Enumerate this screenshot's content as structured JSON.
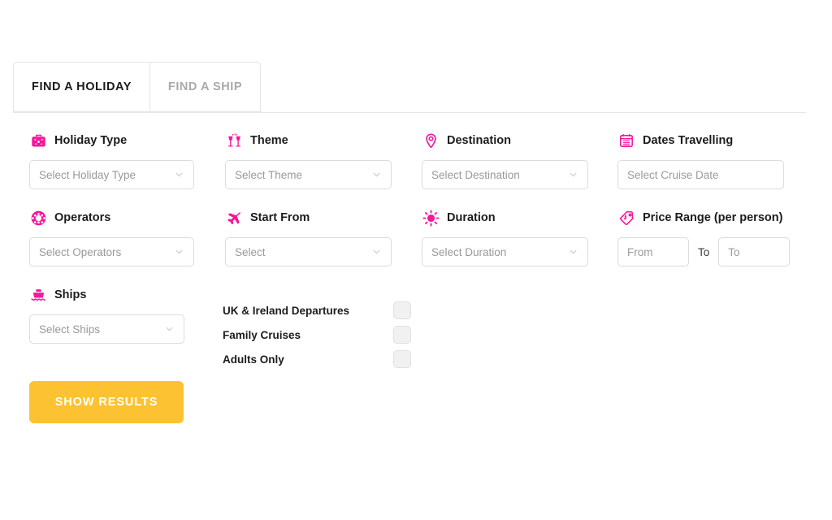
{
  "tabs": [
    {
      "label": "FIND A HOLIDAY",
      "active": true,
      "name": "tab-find-a-holiday"
    },
    {
      "label": "FIND A SHIP",
      "active": false,
      "name": "tab-find-a-ship"
    }
  ],
  "colors": {
    "icon_pink": "#f5179c",
    "button_yellow": "#fdc231",
    "button_text": "#ffffff",
    "label_text": "#1c1c1c",
    "placeholder_text": "#999999",
    "field_border": "#dcdcdc",
    "inactive_tab_text": "#a9a9a9"
  },
  "fields": {
    "holiday_type": {
      "label": "Holiday Type",
      "placeholder": "Select Holiday Type",
      "icon": "suitcase-icon",
      "control": "dropdown"
    },
    "theme": {
      "label": "Theme",
      "placeholder": "Select Theme",
      "icon": "champagne-glasses-icon",
      "control": "dropdown"
    },
    "destination": {
      "label": "Destination",
      "placeholder": "Select Destination",
      "icon": "map-pin-icon",
      "control": "dropdown"
    },
    "dates_travelling": {
      "label": "Dates Travelling",
      "placeholder": "Select Cruise Date",
      "value": "",
      "icon": "calendar-icon",
      "control": "text-input"
    },
    "operators": {
      "label": "Operators",
      "placeholder": "Select Operators",
      "icon": "ship-helm-icon",
      "control": "dropdown"
    },
    "start_from": {
      "label": "Start From",
      "placeholder": "Select",
      "icon": "airplane-icon",
      "control": "dropdown"
    },
    "duration": {
      "label": "Duration",
      "placeholder": "Select Duration",
      "icon": "sun-icon",
      "control": "dropdown"
    },
    "price_range": {
      "label": "Price Range (per person)",
      "from_placeholder": "From",
      "from_value": "",
      "separator": "To",
      "to_placeholder": "To",
      "to_value": "",
      "icon": "price-tag-icon",
      "control": "dual-text-input"
    },
    "ships": {
      "label": "Ships",
      "placeholder": "Select Ships",
      "icon": "cruise-ship-icon",
      "control": "dropdown"
    }
  },
  "checkboxes": [
    {
      "label": "UK & Ireland Departures",
      "checked": false,
      "name": "checkbox-uk-ireland-departures"
    },
    {
      "label": "Family Cruises",
      "checked": false,
      "name": "checkbox-family-cruises"
    },
    {
      "label": "Adults Only",
      "checked": false,
      "name": "checkbox-adults-only"
    }
  ],
  "submit": {
    "label": "SHOW RESULTS"
  }
}
